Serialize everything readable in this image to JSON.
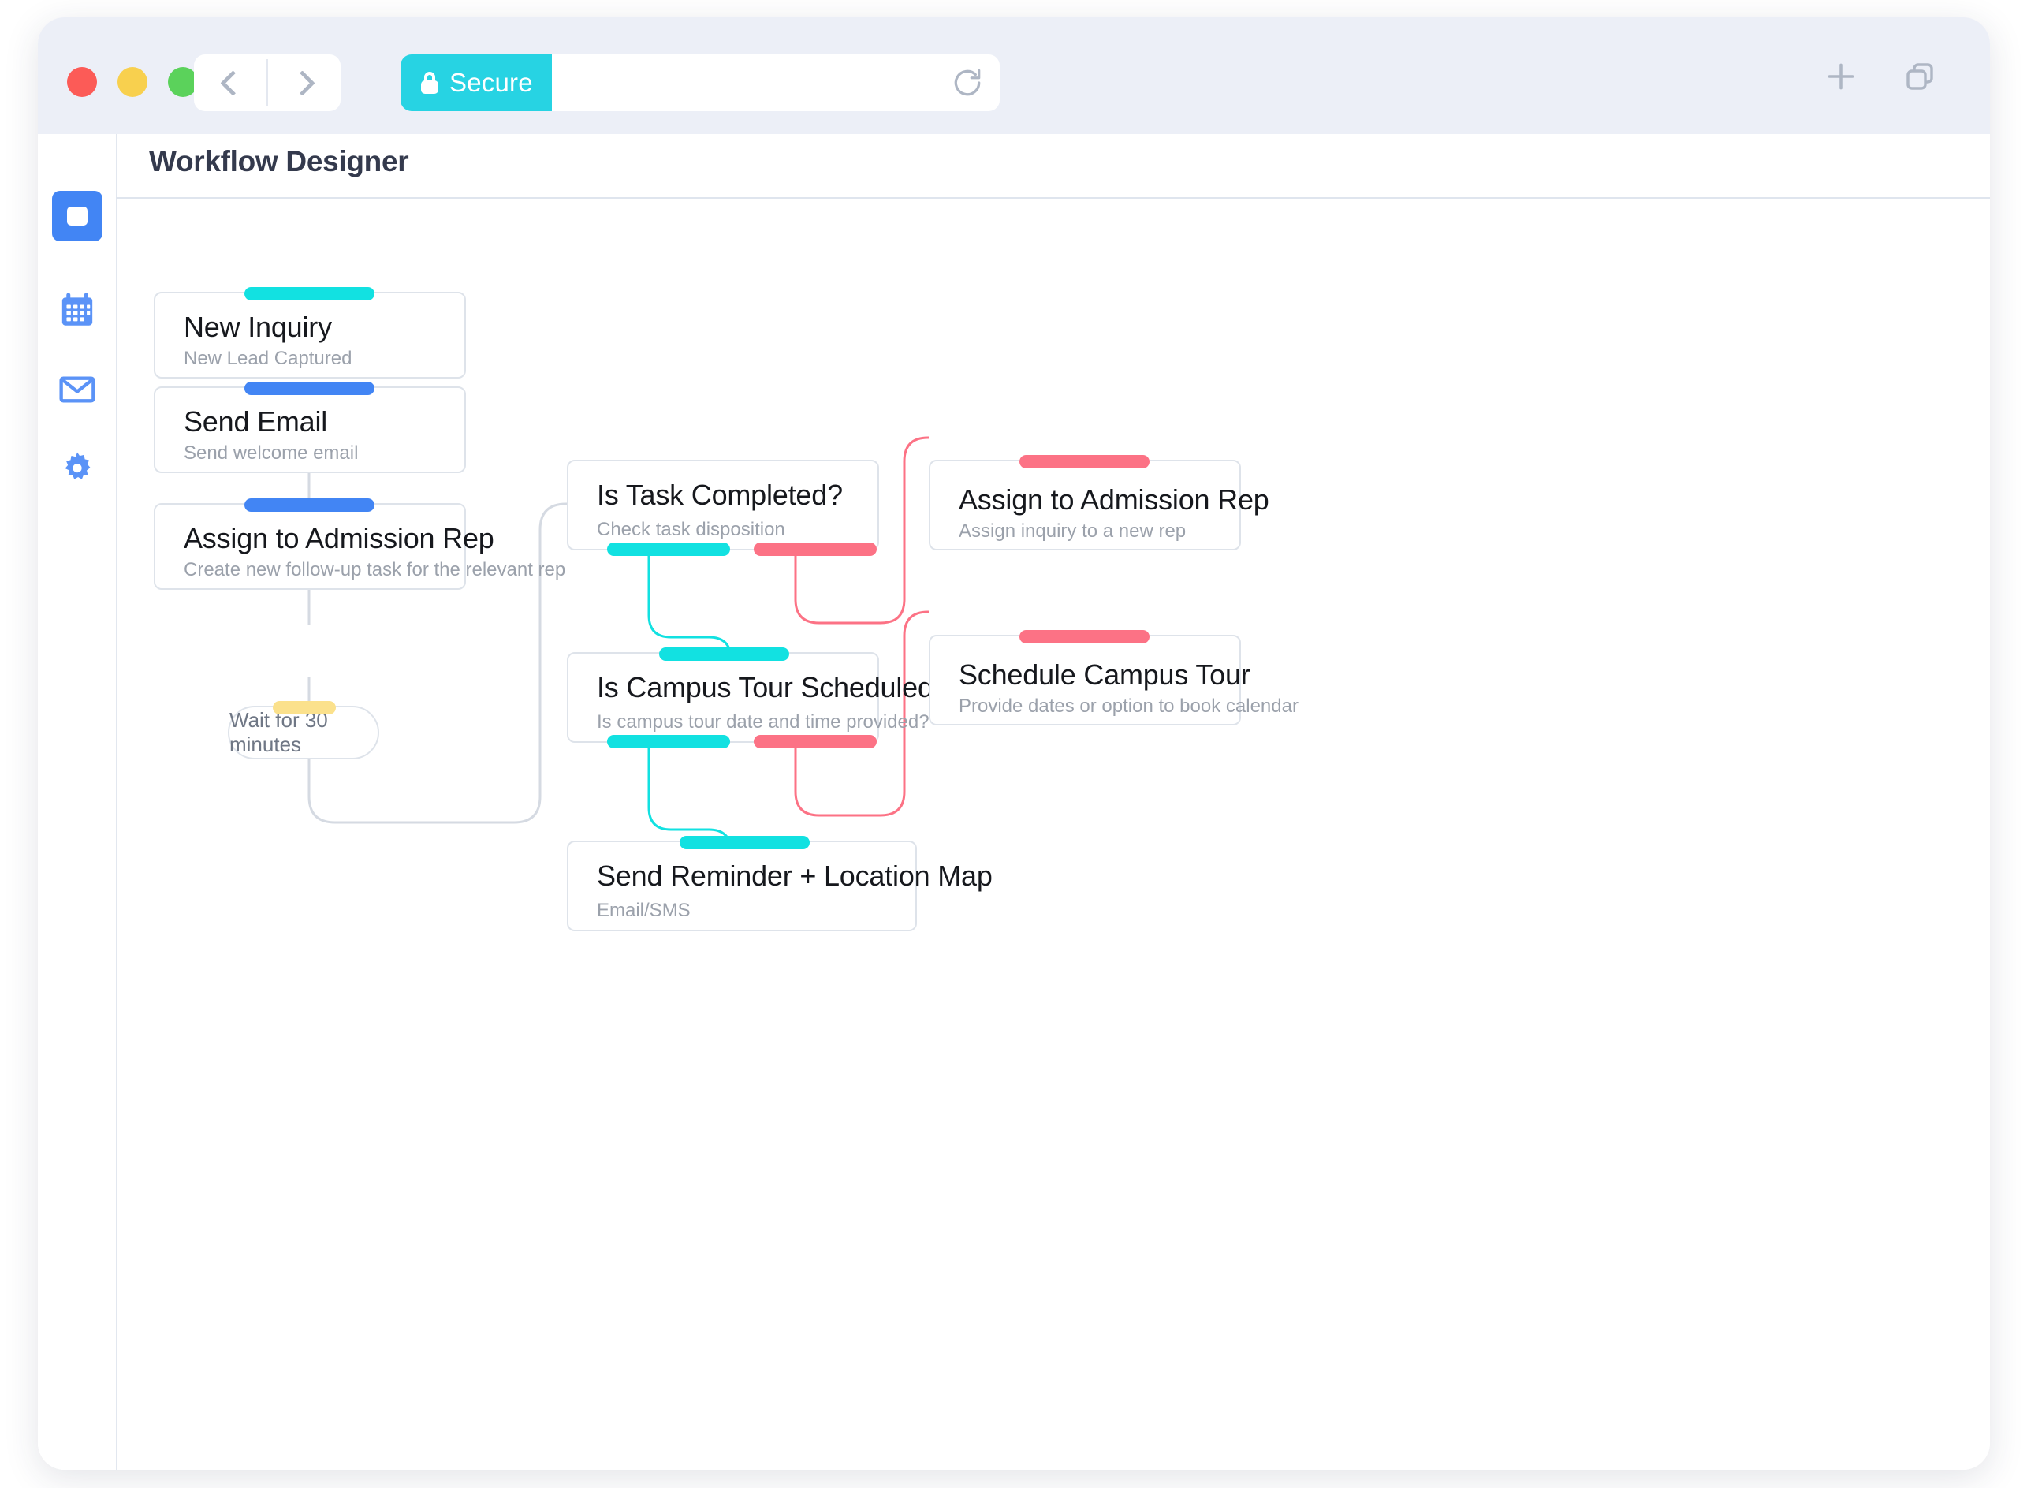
{
  "browser": {
    "traffic_lights": [
      "close",
      "minimize",
      "maximize"
    ],
    "back_icon": "chevron-left-icon",
    "forward_icon": "chevron-right-icon",
    "secure_label": "Secure",
    "lock_icon": "lock-icon",
    "url_value": "",
    "url_placeholder": "",
    "reload_icon": "reload-icon",
    "new_tab_icon": "plus-icon",
    "tabs_icon": "copy-tabs-icon"
  },
  "sidebar": {
    "items": [
      {
        "name": "dashboard",
        "icon": "dashboard-square-icon",
        "active": true
      },
      {
        "name": "calendar",
        "icon": "calendar-icon",
        "active": false
      },
      {
        "name": "mail",
        "icon": "envelope-icon",
        "active": false
      },
      {
        "name": "settings",
        "icon": "gear-icon",
        "active": false
      }
    ]
  },
  "header": {
    "title": "Workflow Designer"
  },
  "workflow": {
    "nodes": [
      {
        "id": "new-inquiry",
        "title": "New Inquiry",
        "subtitle": "New Lead Captured",
        "top_tab_color": "cyan"
      },
      {
        "id": "send-email",
        "title": "Send Email",
        "subtitle": "Send welcome email",
        "top_tab_color": "blue"
      },
      {
        "id": "assign-admission-rep",
        "title": "Assign to Admission Rep",
        "subtitle": "Create new follow-up task for the relevant rep",
        "top_tab_color": "blue"
      },
      {
        "id": "is-task-completed",
        "title": "Is Task Completed?",
        "subtitle": "Check task disposition",
        "bottom_tab_colors": [
          "cyan",
          "red"
        ]
      },
      {
        "id": "assign-admission-rep-2",
        "title": "Assign to Admission Rep",
        "subtitle": "Assign inquiry to a new rep",
        "top_tab_color": "red"
      },
      {
        "id": "is-campus-tour-scheduled",
        "title": "Is Campus Tour Scheduled?",
        "subtitle": "Is campus tour date and time provided?",
        "top_tab_color": "cyan",
        "bottom_tab_colors": [
          "cyan",
          "red"
        ]
      },
      {
        "id": "schedule-campus-tour",
        "title": "Schedule Campus Tour",
        "subtitle": "Provide dates or option to book calendar",
        "top_tab_color": "red"
      },
      {
        "id": "send-reminder",
        "title": "Send Reminder + Location Map",
        "subtitle": "Email/SMS",
        "top_tab_color": "cyan"
      }
    ],
    "delay_node": {
      "id": "wait-delay",
      "label": "Wait for 30 minutes",
      "top_tab_color": "yellow"
    }
  },
  "colors": {
    "cyan": "#12e1e1",
    "blue": "#4285f4",
    "red": "#fc7285",
    "yellow": "#fbe18c",
    "secure_badge": "#27d3e3",
    "connector_gray": "#d5dae2",
    "title_text": "#343a4d",
    "subtitle_text": "#9ba1ab"
  }
}
